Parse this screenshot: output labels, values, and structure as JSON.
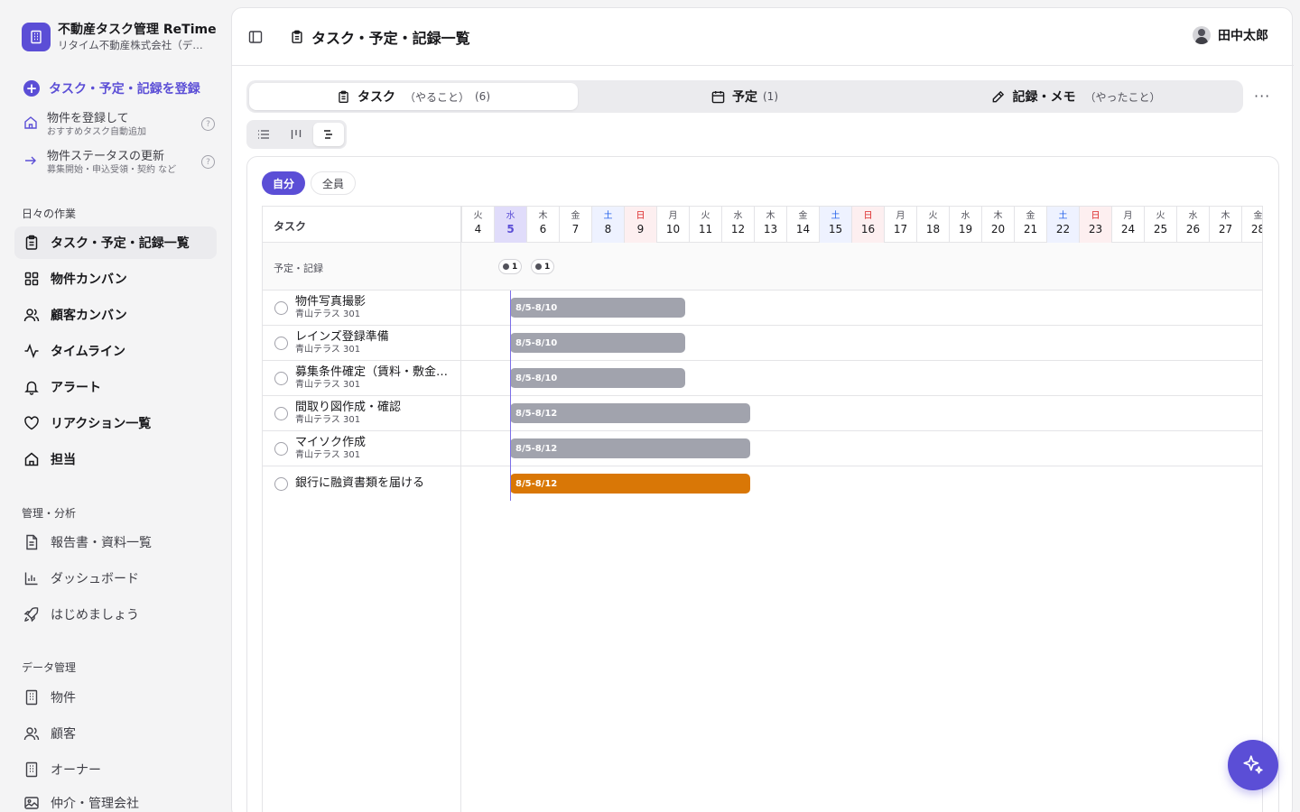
{
  "brand": {
    "title": "不動産タスク管理 ReTime",
    "subtitle": "リタイム不動産株式会社（デモ）",
    "accent": "#5b4ed6"
  },
  "sidebar": {
    "cta_label": "タスク・予定・記録を登録",
    "helpers": [
      {
        "title": "物件を登録して",
        "sub": "おすすめタスク自動追加",
        "help": "?"
      },
      {
        "title": "物件ステータスの更新",
        "sub": "募集開始・申込受領・契約 など",
        "help": "?"
      }
    ],
    "sections": {
      "daily": "日々の作業",
      "analysis": "管理・分析",
      "data": "データ管理"
    },
    "daily_items": [
      {
        "label": "タスク・予定・記録一覧",
        "icon": "clipboard-icon"
      },
      {
        "label": "物件カンバン",
        "icon": "grid-icon"
      },
      {
        "label": "顧客カンバン",
        "icon": "users-icon"
      },
      {
        "label": "タイムライン",
        "icon": "activity-icon"
      },
      {
        "label": "アラート",
        "icon": "bell-icon"
      },
      {
        "label": "リアクション一覧",
        "icon": "heart-icon"
      },
      {
        "label": "担当",
        "icon": "home-icon"
      }
    ],
    "analysis_items": [
      {
        "label": "報告書・資料一覧",
        "icon": "file-icon"
      },
      {
        "label": "ダッシュボード",
        "icon": "bar-chart-icon"
      },
      {
        "label": "はじめましょう",
        "icon": "rocket-icon"
      }
    ],
    "data_items": [
      {
        "label": "物件",
        "icon": "building-icon"
      },
      {
        "label": "顧客",
        "icon": "users-icon"
      },
      {
        "label": "オーナー",
        "icon": "building-icon"
      },
      {
        "label": "仲介・管理会社",
        "icon": "image-icon"
      }
    ]
  },
  "header": {
    "title": "タスク・予定・記録一覧",
    "user_name": "田中太郎"
  },
  "tabs": [
    {
      "label": "タスク",
      "sub": "（やること）",
      "count": "(6)",
      "icon": "clipboard-icon"
    },
    {
      "label": "予定",
      "sub": "",
      "count": "(1)",
      "icon": "calendar-icon"
    },
    {
      "label": "記録・メモ",
      "sub": "（やったこと）",
      "count": "",
      "icon": "pencil-icon"
    }
  ],
  "more_label": "···",
  "filters": {
    "self": "自分",
    "all": "全員"
  },
  "gantt": {
    "task_header": "タスク",
    "event_row_label": "予定・記録",
    "event_counts": [
      "1",
      "1"
    ],
    "days": [
      {
        "w": "火",
        "d": "4"
      },
      {
        "w": "水",
        "d": "5"
      },
      {
        "w": "木",
        "d": "6"
      },
      {
        "w": "金",
        "d": "7"
      },
      {
        "w": "土",
        "d": "8"
      },
      {
        "w": "日",
        "d": "9"
      },
      {
        "w": "月",
        "d": "10"
      },
      {
        "w": "火",
        "d": "11"
      },
      {
        "w": "水",
        "d": "12"
      },
      {
        "w": "木",
        "d": "13"
      },
      {
        "w": "金",
        "d": "14"
      },
      {
        "w": "土",
        "d": "15"
      },
      {
        "w": "日",
        "d": "16"
      },
      {
        "w": "月",
        "d": "17"
      },
      {
        "w": "火",
        "d": "18"
      },
      {
        "w": "水",
        "d": "19"
      },
      {
        "w": "木",
        "d": "20"
      },
      {
        "w": "金",
        "d": "21"
      },
      {
        "w": "土",
        "d": "22"
      },
      {
        "w": "日",
        "d": "23"
      },
      {
        "w": "月",
        "d": "24"
      },
      {
        "w": "火",
        "d": "25"
      },
      {
        "w": "水",
        "d": "26"
      },
      {
        "w": "木",
        "d": "27"
      },
      {
        "w": "金",
        "d": "28"
      }
    ],
    "tasks": [
      {
        "name": "物件写真撮影",
        "property": "青山テラス 301",
        "range": "8/5-8/10"
      },
      {
        "name": "レインズ登録準備",
        "property": "青山テラス 301",
        "range": "8/5-8/10"
      },
      {
        "name": "募集条件確定（賃料・敷金・礼金）",
        "property": "青山テラス 301",
        "range": "8/5-8/10"
      },
      {
        "name": "間取り図作成・確認",
        "property": "青山テラス 301",
        "range": "8/5-8/12"
      },
      {
        "name": "マイソク作成",
        "property": "青山テラス 301",
        "range": "8/5-8/12"
      },
      {
        "name": "銀行に融資書類を届ける",
        "property": "",
        "range": "8/5-8/12"
      }
    ],
    "colors": {
      "bar_default": "#a1a3ad",
      "bar_alert": "#d97706",
      "today": "#5b4ed6"
    }
  }
}
